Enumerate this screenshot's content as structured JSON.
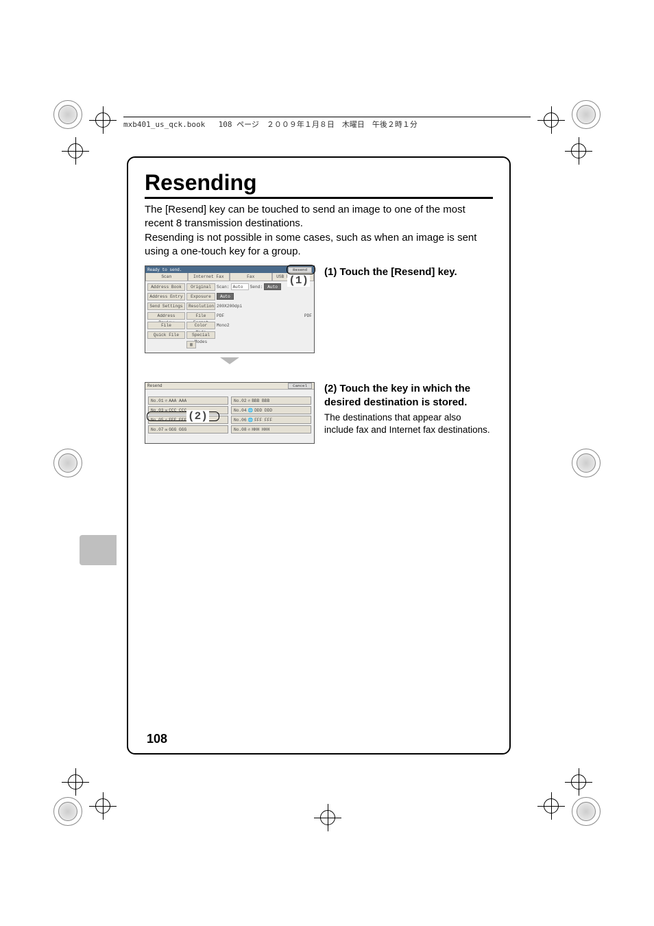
{
  "header": {
    "filename": "mxb401_us_qck.book",
    "page_info": "108 ページ　２００９年１月８日　木曜日　午後２時１分"
  },
  "title": "Resending",
  "intro": "The [Resend] key can be touched to send an image to one of the most recent 8 transmission destinations.\nResending is not possible in some cases, such as when an image is sent using a one-touch key for a group.",
  "step1": {
    "num": "(1)",
    "head": "Touch the [Resend] key.",
    "callout": "(1)"
  },
  "step2": {
    "num": "(2)",
    "head": "Touch the key in which the desired destination is stored.",
    "note": "The destinations that appear also include fax and Internet fax destinations.",
    "callout": "(2)"
  },
  "screen1": {
    "status": "Ready to send.",
    "resend_btn": "Resend",
    "tabs": [
      "Scan",
      "Internet Fax",
      "Fax",
      "USB Mem. Scan"
    ],
    "rows": {
      "address_book": "Address Book",
      "original": "Original",
      "scan_lbl": "Scan:",
      "scan_val": "Auto",
      "send_lbl": "Send:",
      "send_val": "Auto",
      "address_entry": "Address Entry",
      "exposure": "Exposure",
      "exposure_val": "Auto",
      "send_settings": "Send Settings",
      "resolution": "Resolution",
      "resolution_val": "200X200dpi",
      "address_review": "Address Review",
      "file_format": "File Format",
      "ff_val1": "PDF",
      "ff_val2": "PDF",
      "file": "File",
      "color_mode": "Color Mode",
      "color_val": "Mono2",
      "quick_file": "Quick File",
      "special_modes": "Special Modes"
    }
  },
  "screen2": {
    "title": "Resend",
    "cancel": "Cancel",
    "items": [
      {
        "no": "No.01",
        "name": "AAA AAA",
        "icon": "phone"
      },
      {
        "no": "No.02",
        "name": "BBB BBB",
        "icon": "phone"
      },
      {
        "no": "No.03",
        "name": "CCC CCC",
        "icon": "mail"
      },
      {
        "no": "No.04",
        "name": "DDD DDD",
        "icon": "globe"
      },
      {
        "no": "No.05",
        "name": "EEE EEE",
        "icon": "phone"
      },
      {
        "no": "No.06",
        "name": "FFF FFF",
        "icon": "globe"
      },
      {
        "no": "No.07",
        "name": "GGG GGG",
        "icon": "mail"
      },
      {
        "no": "No.08",
        "name": "HHH HHH",
        "icon": "phone"
      }
    ]
  },
  "page_number": "108"
}
